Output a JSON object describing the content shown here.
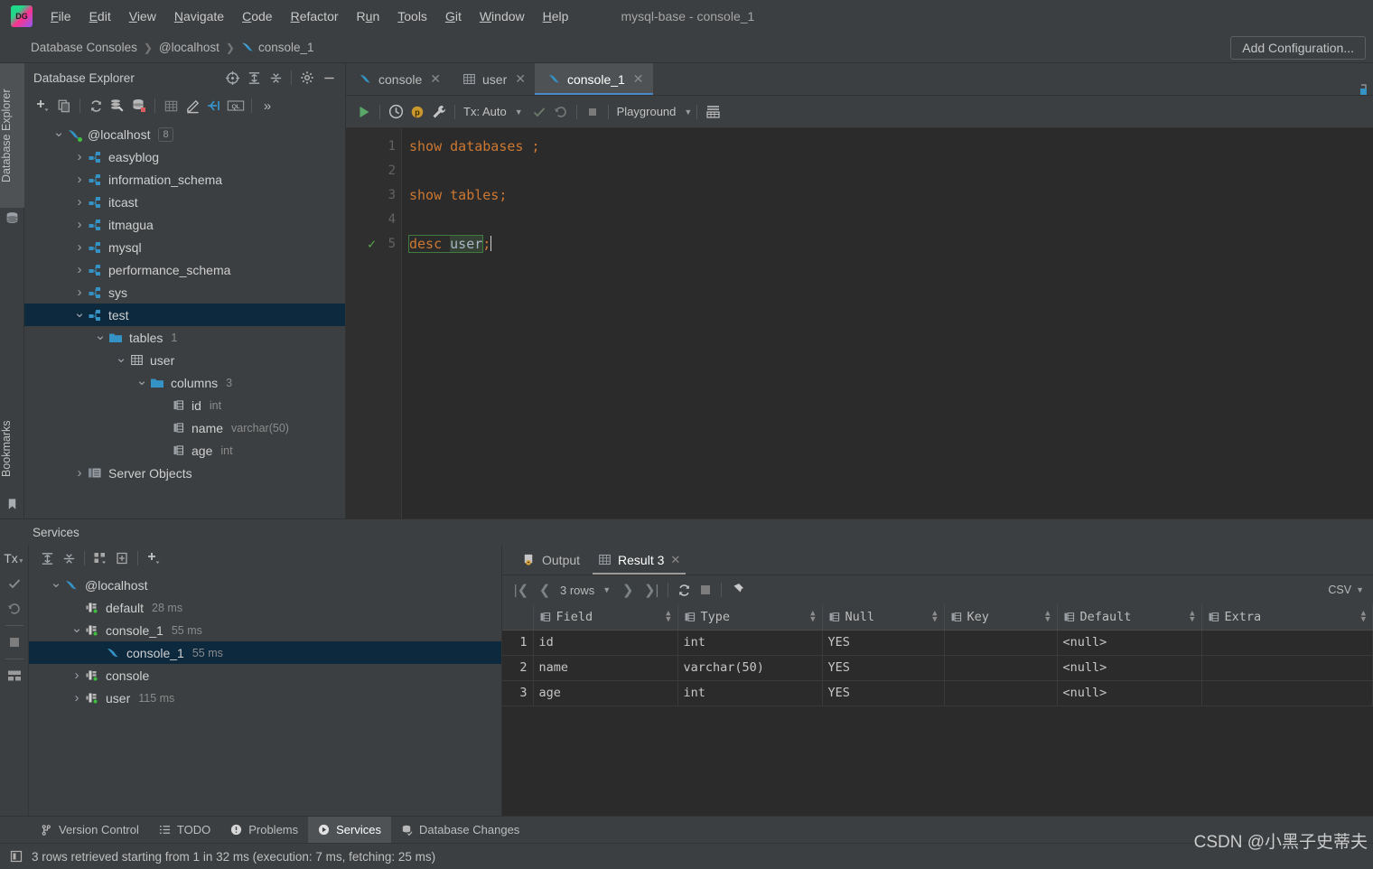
{
  "window": {
    "title": "mysql-base - console_1"
  },
  "menubar": {
    "items": [
      {
        "label": "File",
        "mnemonic": "F"
      },
      {
        "label": "Edit",
        "mnemonic": "E"
      },
      {
        "label": "View",
        "mnemonic": "V"
      },
      {
        "label": "Navigate",
        "mnemonic": "N"
      },
      {
        "label": "Code",
        "mnemonic": "C"
      },
      {
        "label": "Refactor",
        "mnemonic": "R"
      },
      {
        "label": "Run",
        "mnemonic": "u"
      },
      {
        "label": "Tools",
        "mnemonic": "T"
      },
      {
        "label": "Git",
        "mnemonic": "G"
      },
      {
        "label": "Window",
        "mnemonic": "W"
      },
      {
        "label": "Help",
        "mnemonic": "H"
      }
    ]
  },
  "navbar": {
    "crumbs": [
      "Database Consoles",
      "@localhost",
      "console_1"
    ],
    "add_configuration": "Add Configuration..."
  },
  "left_stripe": {
    "database_explorer": "Database Explorer",
    "bookmarks": "Bookmarks"
  },
  "db_explorer": {
    "title": "Database Explorer",
    "head_icons": [
      "locate-icon",
      "expand-all-icon",
      "collapse-all-icon",
      "gear-icon",
      "minimize-icon"
    ],
    "toolbar_icons": [
      "add-icon",
      "copy-icon",
      "refresh-icon",
      "sync-settings-icon",
      "database-color-icon",
      "table-icon",
      "edit-icon",
      "jump-to-icon",
      "ql-console-icon",
      "more-icon"
    ],
    "more_label": "»",
    "tree": [
      {
        "label": "@localhost",
        "badge": "8",
        "depth": 0,
        "arrow": "down",
        "icon": "dolphin-icon",
        "selected": false,
        "meta": ""
      },
      {
        "label": "easyblog",
        "badge": "",
        "depth": 1,
        "arrow": "right",
        "icon": "schema-icon",
        "selected": false,
        "meta": ""
      },
      {
        "label": "information_schema",
        "badge": "",
        "depth": 1,
        "arrow": "right",
        "icon": "schema-icon",
        "selected": false,
        "meta": ""
      },
      {
        "label": "itcast",
        "badge": "",
        "depth": 1,
        "arrow": "right",
        "icon": "schema-icon",
        "selected": false,
        "meta": ""
      },
      {
        "label": "itmagua",
        "badge": "",
        "depth": 1,
        "arrow": "right",
        "icon": "schema-icon",
        "selected": false,
        "meta": ""
      },
      {
        "label": "mysql",
        "badge": "",
        "depth": 1,
        "arrow": "right",
        "icon": "schema-icon",
        "selected": false,
        "meta": ""
      },
      {
        "label": "performance_schema",
        "badge": "",
        "depth": 1,
        "arrow": "right",
        "icon": "schema-icon",
        "selected": false,
        "meta": ""
      },
      {
        "label": "sys",
        "badge": "",
        "depth": 1,
        "arrow": "right",
        "icon": "schema-icon",
        "selected": false,
        "meta": ""
      },
      {
        "label": "test",
        "badge": "",
        "depth": 1,
        "arrow": "down",
        "icon": "schema-icon",
        "selected": true,
        "meta": ""
      },
      {
        "label": "tables",
        "badge": "",
        "depth": 2,
        "arrow": "down",
        "icon": "folder-icon",
        "selected": false,
        "meta": "1"
      },
      {
        "label": "user",
        "badge": "",
        "depth": 3,
        "arrow": "down",
        "icon": "table-icon",
        "selected": false,
        "meta": ""
      },
      {
        "label": "columns",
        "badge": "",
        "depth": 4,
        "arrow": "down",
        "icon": "folder-icon",
        "selected": false,
        "meta": "3"
      },
      {
        "label": "id",
        "badge": "",
        "depth": 5,
        "arrow": "none",
        "icon": "column-icon",
        "selected": false,
        "meta": "int"
      },
      {
        "label": "name",
        "badge": "",
        "depth": 5,
        "arrow": "none",
        "icon": "column-icon",
        "selected": false,
        "meta": "varchar(50)"
      },
      {
        "label": "age",
        "badge": "",
        "depth": 5,
        "arrow": "none",
        "icon": "column-icon",
        "selected": false,
        "meta": "int"
      },
      {
        "label": "Server Objects",
        "badge": "",
        "depth": 1,
        "arrow": "right",
        "icon": "server-objects-icon",
        "selected": false,
        "meta": ""
      }
    ]
  },
  "editor": {
    "tabs": [
      {
        "label": "console",
        "icon": "dolphin-icon",
        "active": false
      },
      {
        "label": "user",
        "icon": "table-icon",
        "active": false
      },
      {
        "label": "console_1",
        "icon": "dolphin-icon",
        "active": true
      }
    ],
    "toolbar": {
      "run_label": "run-icon",
      "history_label": "history-icon",
      "profile_label": "p",
      "wrench_label": "wrench-icon",
      "tx_label": "Tx: Auto",
      "commit_label": "commit-icon",
      "rollback_label": "rollback-icon",
      "stop_label": "stop-icon",
      "schema_label": "Playground",
      "grid_label": "output-format-icon"
    },
    "lines": [
      {
        "num": "1",
        "status": "",
        "tokens": [
          {
            "t": "show databases ;",
            "c": "kw"
          }
        ]
      },
      {
        "num": "2",
        "status": "",
        "tokens": []
      },
      {
        "num": "3",
        "status": "",
        "tokens": [
          {
            "t": "show tables;",
            "c": "kw"
          }
        ]
      },
      {
        "num": "4",
        "status": "",
        "tokens": []
      },
      {
        "num": "5",
        "status": "ok",
        "tokens": [
          {
            "t": "desc ",
            "c": "kw"
          },
          {
            "t": "user",
            "c": "id"
          },
          {
            "t": ";",
            "c": "kw"
          }
        ]
      }
    ]
  },
  "services": {
    "title": "Services",
    "rail": [
      "tx-icon",
      "commit-icon",
      "rollback-icon",
      "stop-icon",
      "layout-icon"
    ],
    "toolbar_icons": [
      "expand-all-icon",
      "collapse-all-icon",
      "group-icon",
      "open-tab-icon",
      "add-icon"
    ],
    "tree": [
      {
        "label": "@localhost",
        "time": "",
        "depth": 0,
        "arrow": "down",
        "icon": "dolphin-icon",
        "selected": false
      },
      {
        "label": "default",
        "time": "28 ms",
        "depth": 1,
        "arrow": "none",
        "icon": "connection-icon",
        "selected": false
      },
      {
        "label": "console_1",
        "time": "55 ms",
        "depth": 1,
        "arrow": "down",
        "icon": "connection-icon",
        "selected": false
      },
      {
        "label": "console_1",
        "time": "55 ms",
        "depth": 2,
        "arrow": "none",
        "icon": "dolphin-icon",
        "selected": true
      },
      {
        "label": "console",
        "time": "",
        "depth": 1,
        "arrow": "right",
        "icon": "connection-icon",
        "selected": false
      },
      {
        "label": "user",
        "time": "115 ms",
        "depth": 1,
        "arrow": "right",
        "icon": "connection-icon",
        "selected": false
      }
    ]
  },
  "result": {
    "tabs": [
      {
        "label": "Output",
        "icon": "output-icon",
        "active": false,
        "closable": false
      },
      {
        "label": "Result 3",
        "icon": "table-icon",
        "active": true,
        "closable": true
      }
    ],
    "toolbar": {
      "rows_label": "3 rows",
      "first_icon": "first-page-icon",
      "prev_icon": "prev-page-icon",
      "next_icon": "next-page-icon",
      "last_icon": "last-page-icon",
      "reload_icon": "reload-icon",
      "stop_icon": "stop-icon",
      "pin_icon": "pin-icon",
      "export_format": "CSV"
    },
    "columns": [
      "Field",
      "Type",
      "Null",
      "Key",
      "Default",
      "Extra"
    ],
    "rows": [
      {
        "n": "1",
        "Field": "id",
        "Type": "int",
        "Null": "YES",
        "Key": "",
        "Default": "<null>",
        "Extra": ""
      },
      {
        "n": "2",
        "Field": "name",
        "Type": "varchar(50)",
        "Null": "YES",
        "Key": "",
        "Default": "<null>",
        "Extra": ""
      },
      {
        "n": "3",
        "Field": "age",
        "Type": "int",
        "Null": "YES",
        "Key": "",
        "Default": "<null>",
        "Extra": ""
      }
    ]
  },
  "tool_window_bar": {
    "items": [
      {
        "label": "Version Control",
        "icon": "branch-icon",
        "active": false
      },
      {
        "label": "TODO",
        "icon": "todo-icon",
        "active": false
      },
      {
        "label": "Problems",
        "icon": "problems-icon",
        "active": false
      },
      {
        "label": "Services",
        "icon": "services-icon",
        "active": true
      },
      {
        "label": "Database Changes",
        "icon": "db-changes-icon",
        "active": false
      }
    ]
  },
  "statusbar": {
    "message": "3 rows retrieved starting from 1 in 32 ms (execution: 7 ms, fetching: 25 ms)",
    "icon": "console-icon"
  },
  "watermark": {
    "text": "CSDN @小黑子史蒂夫"
  },
  "colors": {
    "accent_blue": "#4a88c7",
    "selection": "#0d293e",
    "keyword_orange": "#cc7832",
    "ok_green": "#57a64a",
    "panel_bg": "#3c3f41",
    "editor_bg": "#2b2b2b"
  }
}
